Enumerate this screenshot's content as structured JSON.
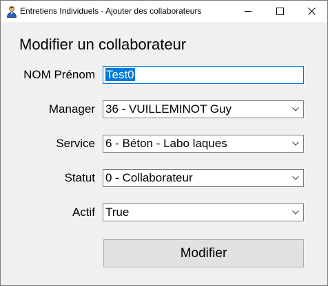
{
  "window": {
    "title": "Entretiens Individuels - Ajouter des collaborateurs",
    "icon": "user-icon"
  },
  "form": {
    "heading": "Modifier un collaborateur",
    "name": {
      "label": "NOM Prénom",
      "value": "Test0"
    },
    "manager": {
      "label": "Manager",
      "value": "36 - VUILLEMINOT Guy"
    },
    "service": {
      "label": "Service",
      "value": "6 - Béton - Labo laques"
    },
    "statut": {
      "label": "Statut",
      "value": "0 - Collaborateur"
    },
    "actif": {
      "label": "Actif",
      "value": "True"
    },
    "submit_label": "Modifier"
  }
}
